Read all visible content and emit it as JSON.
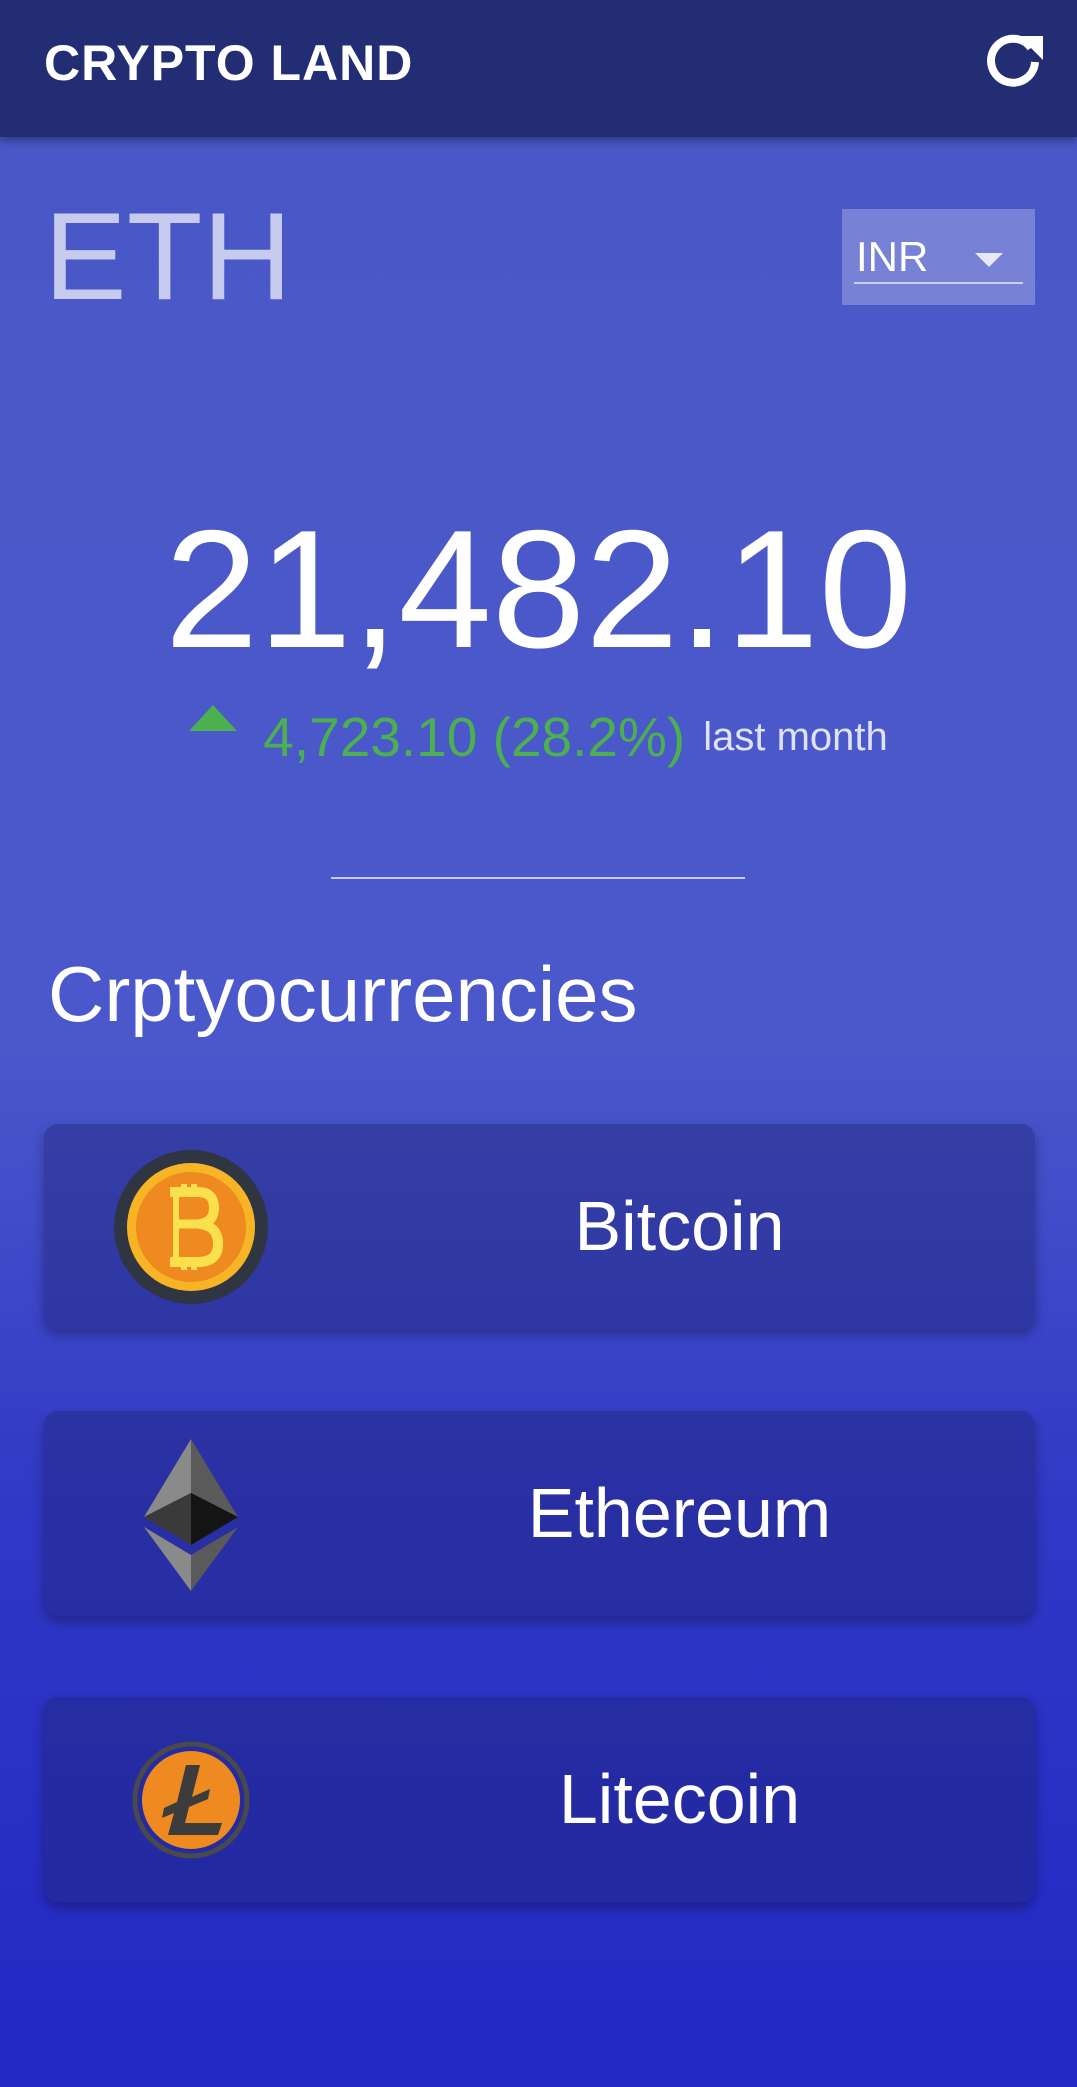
{
  "app_bar": {
    "title": "CRYPTO LAND",
    "refresh_icon": "refresh-icon"
  },
  "selected": {
    "symbol": "ETH",
    "currency": "INR",
    "price": "21,482.10",
    "change": "4,723.10 (28.2%)",
    "change_direction": "up",
    "period": "last month"
  },
  "section_title": "Crptyocurrencies",
  "coins": [
    {
      "name": "Bitcoin",
      "icon": "bitcoin-icon"
    },
    {
      "name": "Ethereum",
      "icon": "ethereum-icon"
    },
    {
      "name": "Litecoin",
      "icon": "litecoin-icon"
    }
  ],
  "colors": {
    "app_bar": "#232d73",
    "positive": "#4caf50",
    "background_top": "#4a58c6",
    "background_bottom": "#2128c4"
  }
}
